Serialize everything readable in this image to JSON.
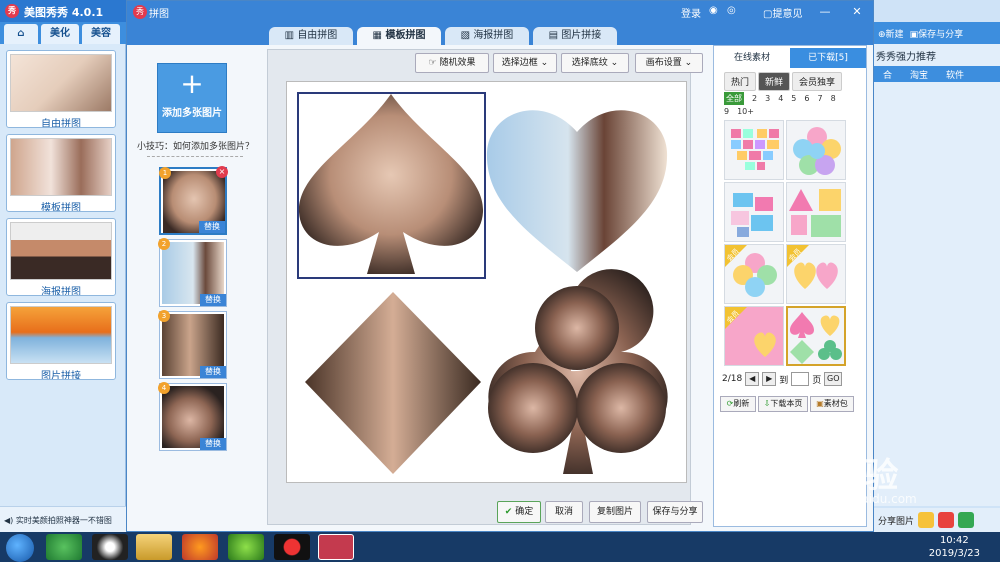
{
  "app": {
    "title": "美图秀秀 4.0.1",
    "logo": "秀",
    "tabs": [
      "美化",
      "美容"
    ],
    "home_icon": "home-icon",
    "categories": [
      "自由拼图",
      "模板拼图",
      "海报拼图",
      "图片拼接"
    ],
    "status_text": "实时美颜拍照神器一不错图",
    "right_toolbar": {
      "new": "新建",
      "save_share": "保存与分享"
    },
    "right_heading": "秀秀强力推荐",
    "right_tabs": [
      "合",
      "淘宝",
      "软件"
    ],
    "share_label": "分享图片"
  },
  "dialog": {
    "title": "拼图",
    "top_menu": {
      "login": "登录",
      "feedback": "提意见"
    },
    "tabs": [
      "自由拼图",
      "模板拼图",
      "海报拼图",
      "图片拼接"
    ],
    "active_tab": 1,
    "add_button": "添加多张图片",
    "tip": "小技巧：如何添加多张图片？",
    "thumbs": [
      {
        "num": "1",
        "replace": "替换",
        "deletable": true
      },
      {
        "num": "2",
        "replace": "替换"
      },
      {
        "num": "3",
        "replace": "替换"
      },
      {
        "num": "4",
        "replace": "替换"
      }
    ],
    "toolbar": [
      "随机效果",
      "选择边框",
      "选择底纹",
      "画布设置"
    ],
    "bottom_buttons": [
      "确定",
      "取消",
      "复制图片",
      "保存与分享"
    ]
  },
  "materials": {
    "tabs": [
      "在线素材",
      "已下载[5]"
    ],
    "chips": [
      "热门",
      "新鲜",
      "会员独享"
    ],
    "numbers": [
      "全部",
      "2",
      "3",
      "4",
      "5",
      "6",
      "7",
      "8",
      "9",
      "10+"
    ],
    "pager": {
      "current": "2/18",
      "goto": "到",
      "page": "页",
      "go": "GO"
    },
    "buttons": [
      "刷新",
      "下载本页",
      "素材包"
    ],
    "member_badge": "会员"
  },
  "taskbar": {
    "time": "10:42",
    "date": "2019/3/23"
  },
  "watermark": {
    "main": "Bai 经验",
    "url": "jingyan.baidu.com"
  }
}
